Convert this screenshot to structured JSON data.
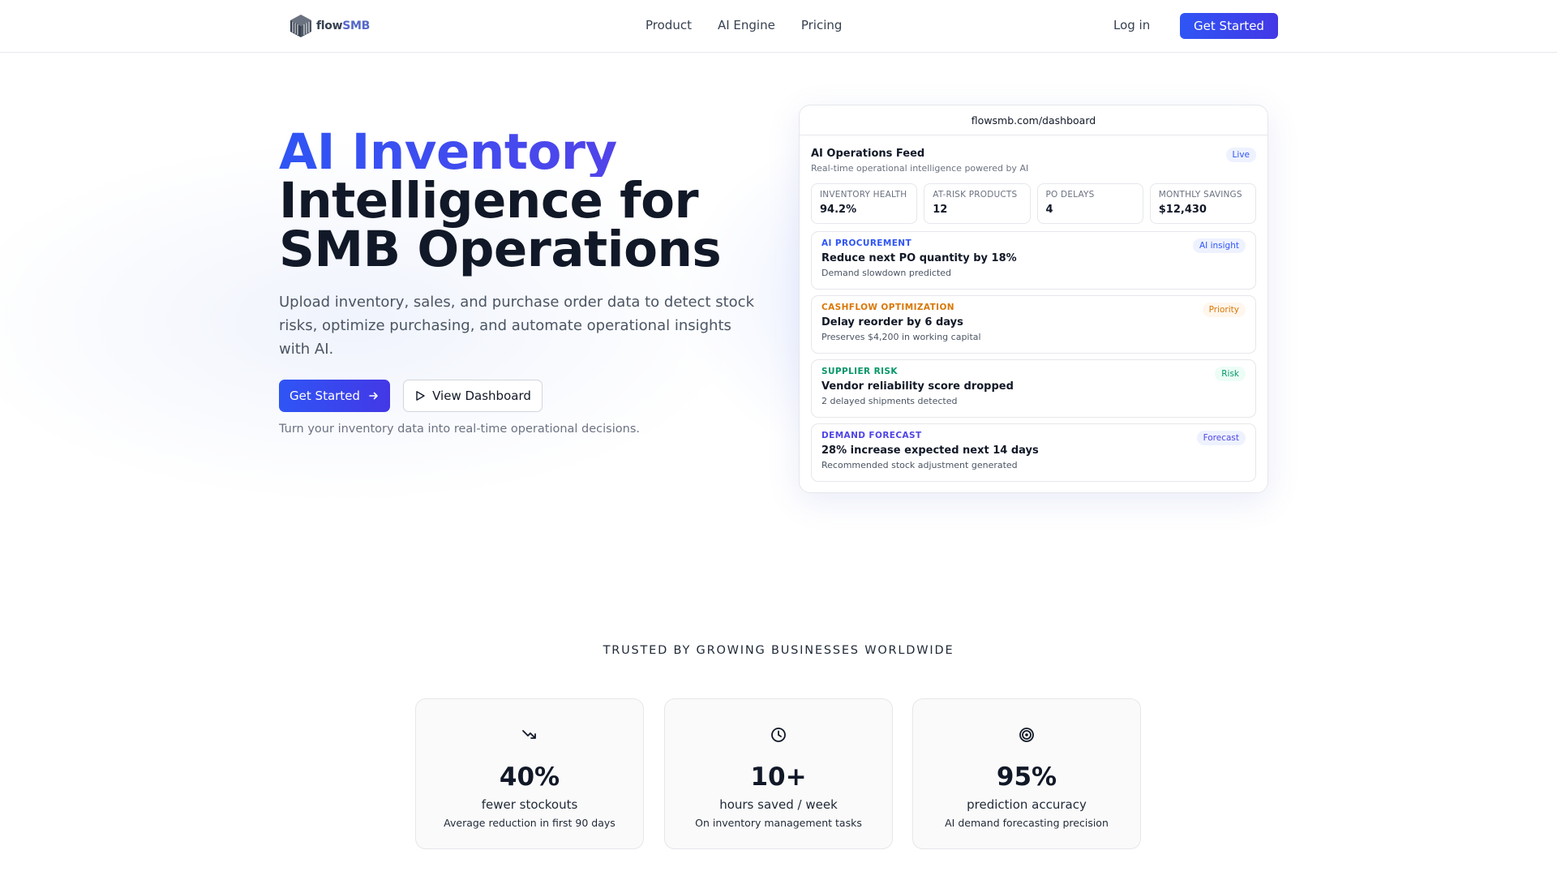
{
  "nav": {
    "brand_prefix": "flow",
    "brand_suffix": "SMB",
    "links": [
      "Product",
      "AI Engine",
      "Pricing"
    ],
    "login": "Log in",
    "cta": "Get Started"
  },
  "hero": {
    "title_accent": "AI Inventory",
    "title_line2": "Intelligence for",
    "title_line3": "SMB Operations",
    "subtitle": "Upload inventory, sales, and purchase order data to detect stock risks, optimize purchasing, and automate operational insights with AI.",
    "primary_cta": "Get Started",
    "secondary_cta": "View Dashboard",
    "tagline": "Turn your inventory data into real-time operational decisions."
  },
  "dashboard": {
    "url": "flowsmb.com/dashboard",
    "feed_title": "AI Operations Feed",
    "feed_subtitle": "Real-time operational intelligence powered by AI",
    "live_label": "Live",
    "kpis": [
      {
        "label": "INVENTORY HEALTH",
        "value": "94.2%"
      },
      {
        "label": "AT-RISK PRODUCTS",
        "value": "12"
      },
      {
        "label": "PO DELAYS",
        "value": "4"
      },
      {
        "label": "MONTHLY SAVINGS",
        "value": "$12,430"
      }
    ],
    "insights": [
      {
        "category": "AI PROCUREMENT",
        "title": "Reduce next PO quantity by 18%",
        "desc": "Demand slowdown predicted",
        "tag": "AI insight",
        "color": "#2f55f5",
        "tag_bg": "#eef2ff"
      },
      {
        "category": "CASHFLOW OPTIMIZATION",
        "title": "Delay reorder by 6 days",
        "desc": "Preserves $4,200 in working capital",
        "tag": "Priority",
        "color": "#d97706",
        "tag_bg": "#fff7ed"
      },
      {
        "category": "SUPPLIER RISK",
        "title": "Vendor reliability score dropped",
        "desc": "2 delayed shipments detected",
        "tag": "Risk",
        "color": "#059669",
        "tag_bg": "#ecfdf5"
      },
      {
        "category": "DEMAND FORECAST",
        "title": "28% increase expected next 14 days",
        "desc": "Recommended stock adjustment generated",
        "tag": "Forecast",
        "color": "#4f46e5",
        "tag_bg": "#eef2ff"
      }
    ]
  },
  "trusted": {
    "heading": "TRUSTED BY GROWING BUSINESSES WORLDWIDE",
    "stats": [
      {
        "icon": "trending-down-icon",
        "value": "40%",
        "label": "fewer stockouts",
        "desc": "Average reduction in first 90 days"
      },
      {
        "icon": "clock-icon",
        "value": "10+",
        "label": "hours saved / week",
        "desc": "On inventory management tasks"
      },
      {
        "icon": "target-icon",
        "value": "95%",
        "label": "prediction accuracy",
        "desc": "AI demand forecasting precision"
      }
    ]
  }
}
